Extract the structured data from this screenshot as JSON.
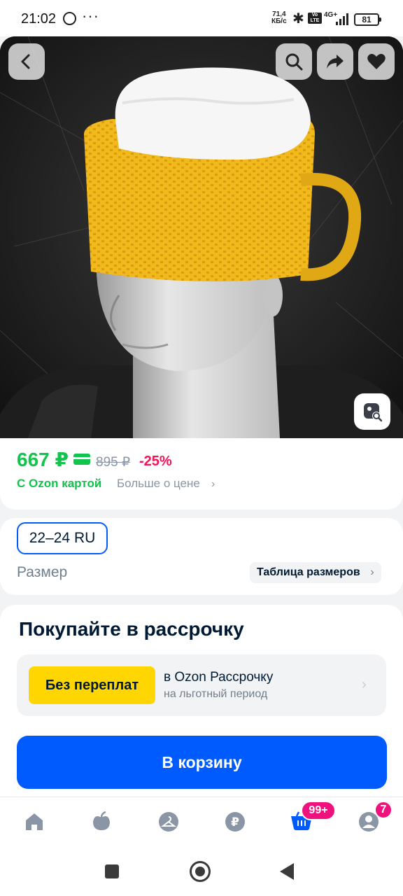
{
  "status_bar": {
    "time": "21:02",
    "more": "···",
    "net_speed_value": "71,4",
    "net_speed_unit": "КБ/с",
    "volte": "Vo LTE",
    "network": "4G+",
    "battery": "81"
  },
  "product": {
    "price": "667 ₽",
    "old_price": "895 ₽",
    "discount": "-25%",
    "ozon_card_label": "С Ozon картой",
    "more_about_price": "Больше о цене"
  },
  "size": {
    "selected": "22–24 RU",
    "label": "Размер",
    "table_link": "Таблица размеров"
  },
  "installment": {
    "title": "Покупайте в рассрочку",
    "badge": "Без переплат",
    "line1": "в Ozon Рассрочку",
    "line2": "на льготный период"
  },
  "cart_button": "В корзину",
  "bottom_nav": {
    "cart_badge": "99+",
    "profile_badge": "7"
  },
  "colors": {
    "accent_blue": "#005bff",
    "price_green": "#10c44c",
    "discount_pink": "#f91155",
    "badge_yellow": "#ffd600",
    "badge_magenta": "#f1117e"
  },
  "icons": [
    "back-icon",
    "search-icon",
    "share-icon",
    "heart-icon",
    "image-search-icon",
    "home-icon",
    "apple-icon",
    "hanger-icon",
    "ruble-icon",
    "cart-icon",
    "profile-icon"
  ]
}
